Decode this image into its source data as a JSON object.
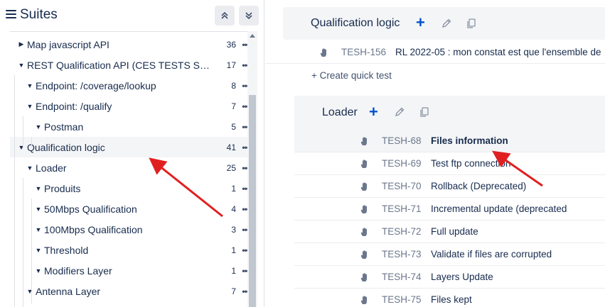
{
  "sidebar": {
    "title": "Suites",
    "items": [
      {
        "label": "Map javascript API",
        "count": "36",
        "expanded": false,
        "level": 1
      },
      {
        "label": "REST Qualification API (CES TESTS SON...",
        "count": "17",
        "expanded": true,
        "level": 1
      },
      {
        "label": "Endpoint: /coverage/lookup",
        "count": "8",
        "expanded": true,
        "level": 2
      },
      {
        "label": "Endpoint: /qualify",
        "count": "7",
        "expanded": true,
        "level": 2
      },
      {
        "label": "Postman",
        "count": "5",
        "expanded": true,
        "level": 3
      },
      {
        "label": "Qualification logic",
        "count": "41",
        "expanded": true,
        "level": 1,
        "selected": true
      },
      {
        "label": "Loader",
        "count": "25",
        "expanded": true,
        "level": 2
      },
      {
        "label": "Produits",
        "count": "1",
        "expanded": true,
        "level": 3
      },
      {
        "label": "50Mbps Qualification",
        "count": "4",
        "expanded": true,
        "level": 3
      },
      {
        "label": "100Mbps Qualification",
        "count": "3",
        "expanded": true,
        "level": 3
      },
      {
        "label": "Threshold",
        "count": "1",
        "expanded": true,
        "level": 3
      },
      {
        "label": "Modifiers Layer",
        "count": "1",
        "expanded": true,
        "level": 3
      },
      {
        "label": "Antenna Layer",
        "count": "7",
        "expanded": true,
        "level": 2
      }
    ]
  },
  "main": {
    "qualification": {
      "title": "Qualification logic",
      "tests": [
        {
          "key": "TESH-156",
          "name": "RL 2022-05 : mon constat est que l'ensemble de"
        }
      ],
      "create_quick_test": "+ Create quick test"
    },
    "loader": {
      "title": "Loader",
      "tests": [
        {
          "key": "TESH-68",
          "name": "Files information",
          "highlight": true
        },
        {
          "key": "TESH-69",
          "name": "Test ftp connection"
        },
        {
          "key": "TESH-70",
          "name": "Rollback (Deprecated)"
        },
        {
          "key": "TESH-71",
          "name": "Incremental update (deprecated"
        },
        {
          "key": "TESH-72",
          "name": "Full update"
        },
        {
          "key": "TESH-73",
          "name": "Validate if files are corrupted"
        },
        {
          "key": "TESH-74",
          "name": "Layers Update"
        },
        {
          "key": "TESH-75",
          "name": "Files kept"
        }
      ]
    }
  },
  "colors": {
    "accent": "#0052cc",
    "arrow": "#e02020",
    "selected_bg": "#f4f5f7"
  },
  "icons": [
    "hamburger-icon",
    "collapse-all-icon",
    "expand-all-icon",
    "plus-icon",
    "pencil-icon",
    "copy-icon",
    "hand-icon",
    "more-icon"
  ]
}
